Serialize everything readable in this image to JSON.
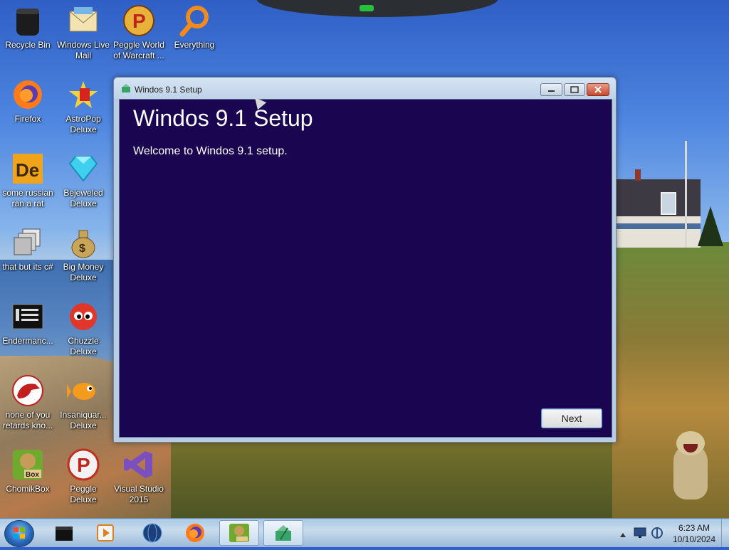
{
  "desktop": {
    "icons": [
      {
        "label": "Recycle Bin"
      },
      {
        "label": "Windows Live Mail"
      },
      {
        "label": "Peggle World of Warcraft ..."
      },
      {
        "label": "Everything"
      },
      {
        "label": "Firefox"
      },
      {
        "label": "AstroPop Deluxe"
      },
      {
        "label": "some russian ran a rat"
      },
      {
        "label": "Bejeweled Deluxe"
      },
      {
        "label": "that but its c#"
      },
      {
        "label": "Big Money Deluxe"
      },
      {
        "label": "Endermanc..."
      },
      {
        "label": "Chuzzle Deluxe"
      },
      {
        "label": "none of you retards kno..."
      },
      {
        "label": "Insaniquar... Deluxe"
      },
      {
        "label": "ChomikBox"
      },
      {
        "label": "Peggle Deluxe"
      },
      {
        "label": "Visual Studio 2015"
      }
    ]
  },
  "window": {
    "title": "Windos 9.1 Setup",
    "heading": "Windos 9.1 Setup",
    "subtitle": "Welcome to Windos 9.1 setup.",
    "next_label": "Next"
  },
  "taskbar": {
    "clock_time": "6:23 AM",
    "clock_date": "10/10/2024"
  },
  "colors": {
    "setup_background": "#1a0550",
    "taskbar": "#b3cde6"
  }
}
